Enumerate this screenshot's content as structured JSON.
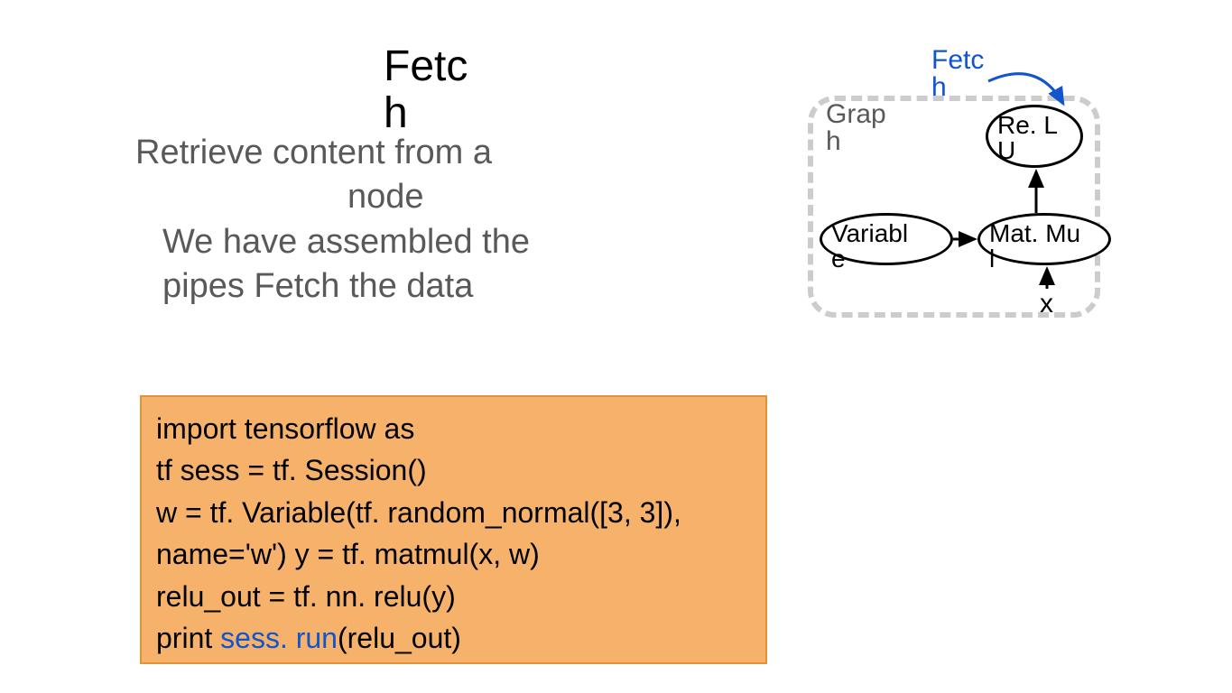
{
  "title": {
    "line1": "Fetc",
    "line2": "h"
  },
  "subtitle": {
    "line1": "Retrieve content from  a",
    "line2": "node",
    "line3": "We have assembled the",
    "line4": "pipes  Fetch the data"
  },
  "code": {
    "l1": "import tensorflow as",
    "l2": "tf  sess = tf. Session()",
    "l3": "w = tf. Variable(tf. random_normal([3, 3]),",
    "l4": "name='w')  y = tf. matmul(x, w)",
    "l5": "relu_out = tf. nn. relu(y)",
    "l6a": "print ",
    "l6b": "sess. run",
    "l6c": "(relu_out)"
  },
  "graph": {
    "label_line1": "Grap",
    "label_line2": "h",
    "fetch_line1": "Fetc",
    "fetch_line2": "h",
    "relu_line1": "Re. L",
    "relu_line2": "U",
    "variable_line1": "Variabl",
    "variable_line2": "e",
    "matmul_line1": "Mat. Mu",
    "matmul_line2": "l",
    "x": "x"
  }
}
